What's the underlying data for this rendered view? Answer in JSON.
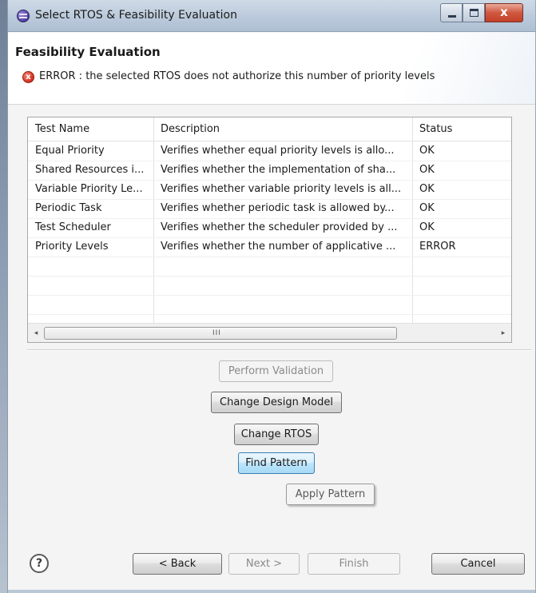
{
  "window": {
    "title": "Select RTOS & Feasibility Evaluation",
    "close_glyph": "x"
  },
  "header": {
    "title": "Feasibility Evaluation",
    "error_icon": "error-x-icon",
    "error_glyph": "x",
    "error_message": "ERROR : the selected RTOS does not authorize this number of priority levels"
  },
  "table": {
    "columns": [
      "Test Name",
      "Description",
      "Status"
    ],
    "rows": [
      [
        "Equal Priority",
        "Verifies whether equal priority levels is allo...",
        "OK"
      ],
      [
        "Shared Resources i...",
        "Verifies whether the implementation of sha...",
        "OK"
      ],
      [
        "Variable Priority Le...",
        "Verifies whether variable priority levels is all...",
        "OK"
      ],
      [
        "Periodic Task",
        "Verifies whether periodic task is allowed by...",
        "OK"
      ],
      [
        "Test Scheduler",
        "Verifies whether the scheduler provided by ...",
        "OK"
      ],
      [
        "Priority Levels",
        "Verifies whether the number of applicative ...",
        "ERROR"
      ]
    ],
    "scrollbar": {
      "left_arrow": "◂",
      "right_arrow": "▸",
      "grip": "III"
    }
  },
  "actions": {
    "perform_validation": "Perform Validation",
    "change_design_model": "Change Design Model",
    "change_rtos": "Change RTOS",
    "find_pattern": "Find Pattern",
    "apply_pattern": "Apply Pattern"
  },
  "footer": {
    "help_glyph": "?",
    "back": "< Back",
    "next": "Next >",
    "finish": "Finish",
    "cancel": "Cancel"
  }
}
